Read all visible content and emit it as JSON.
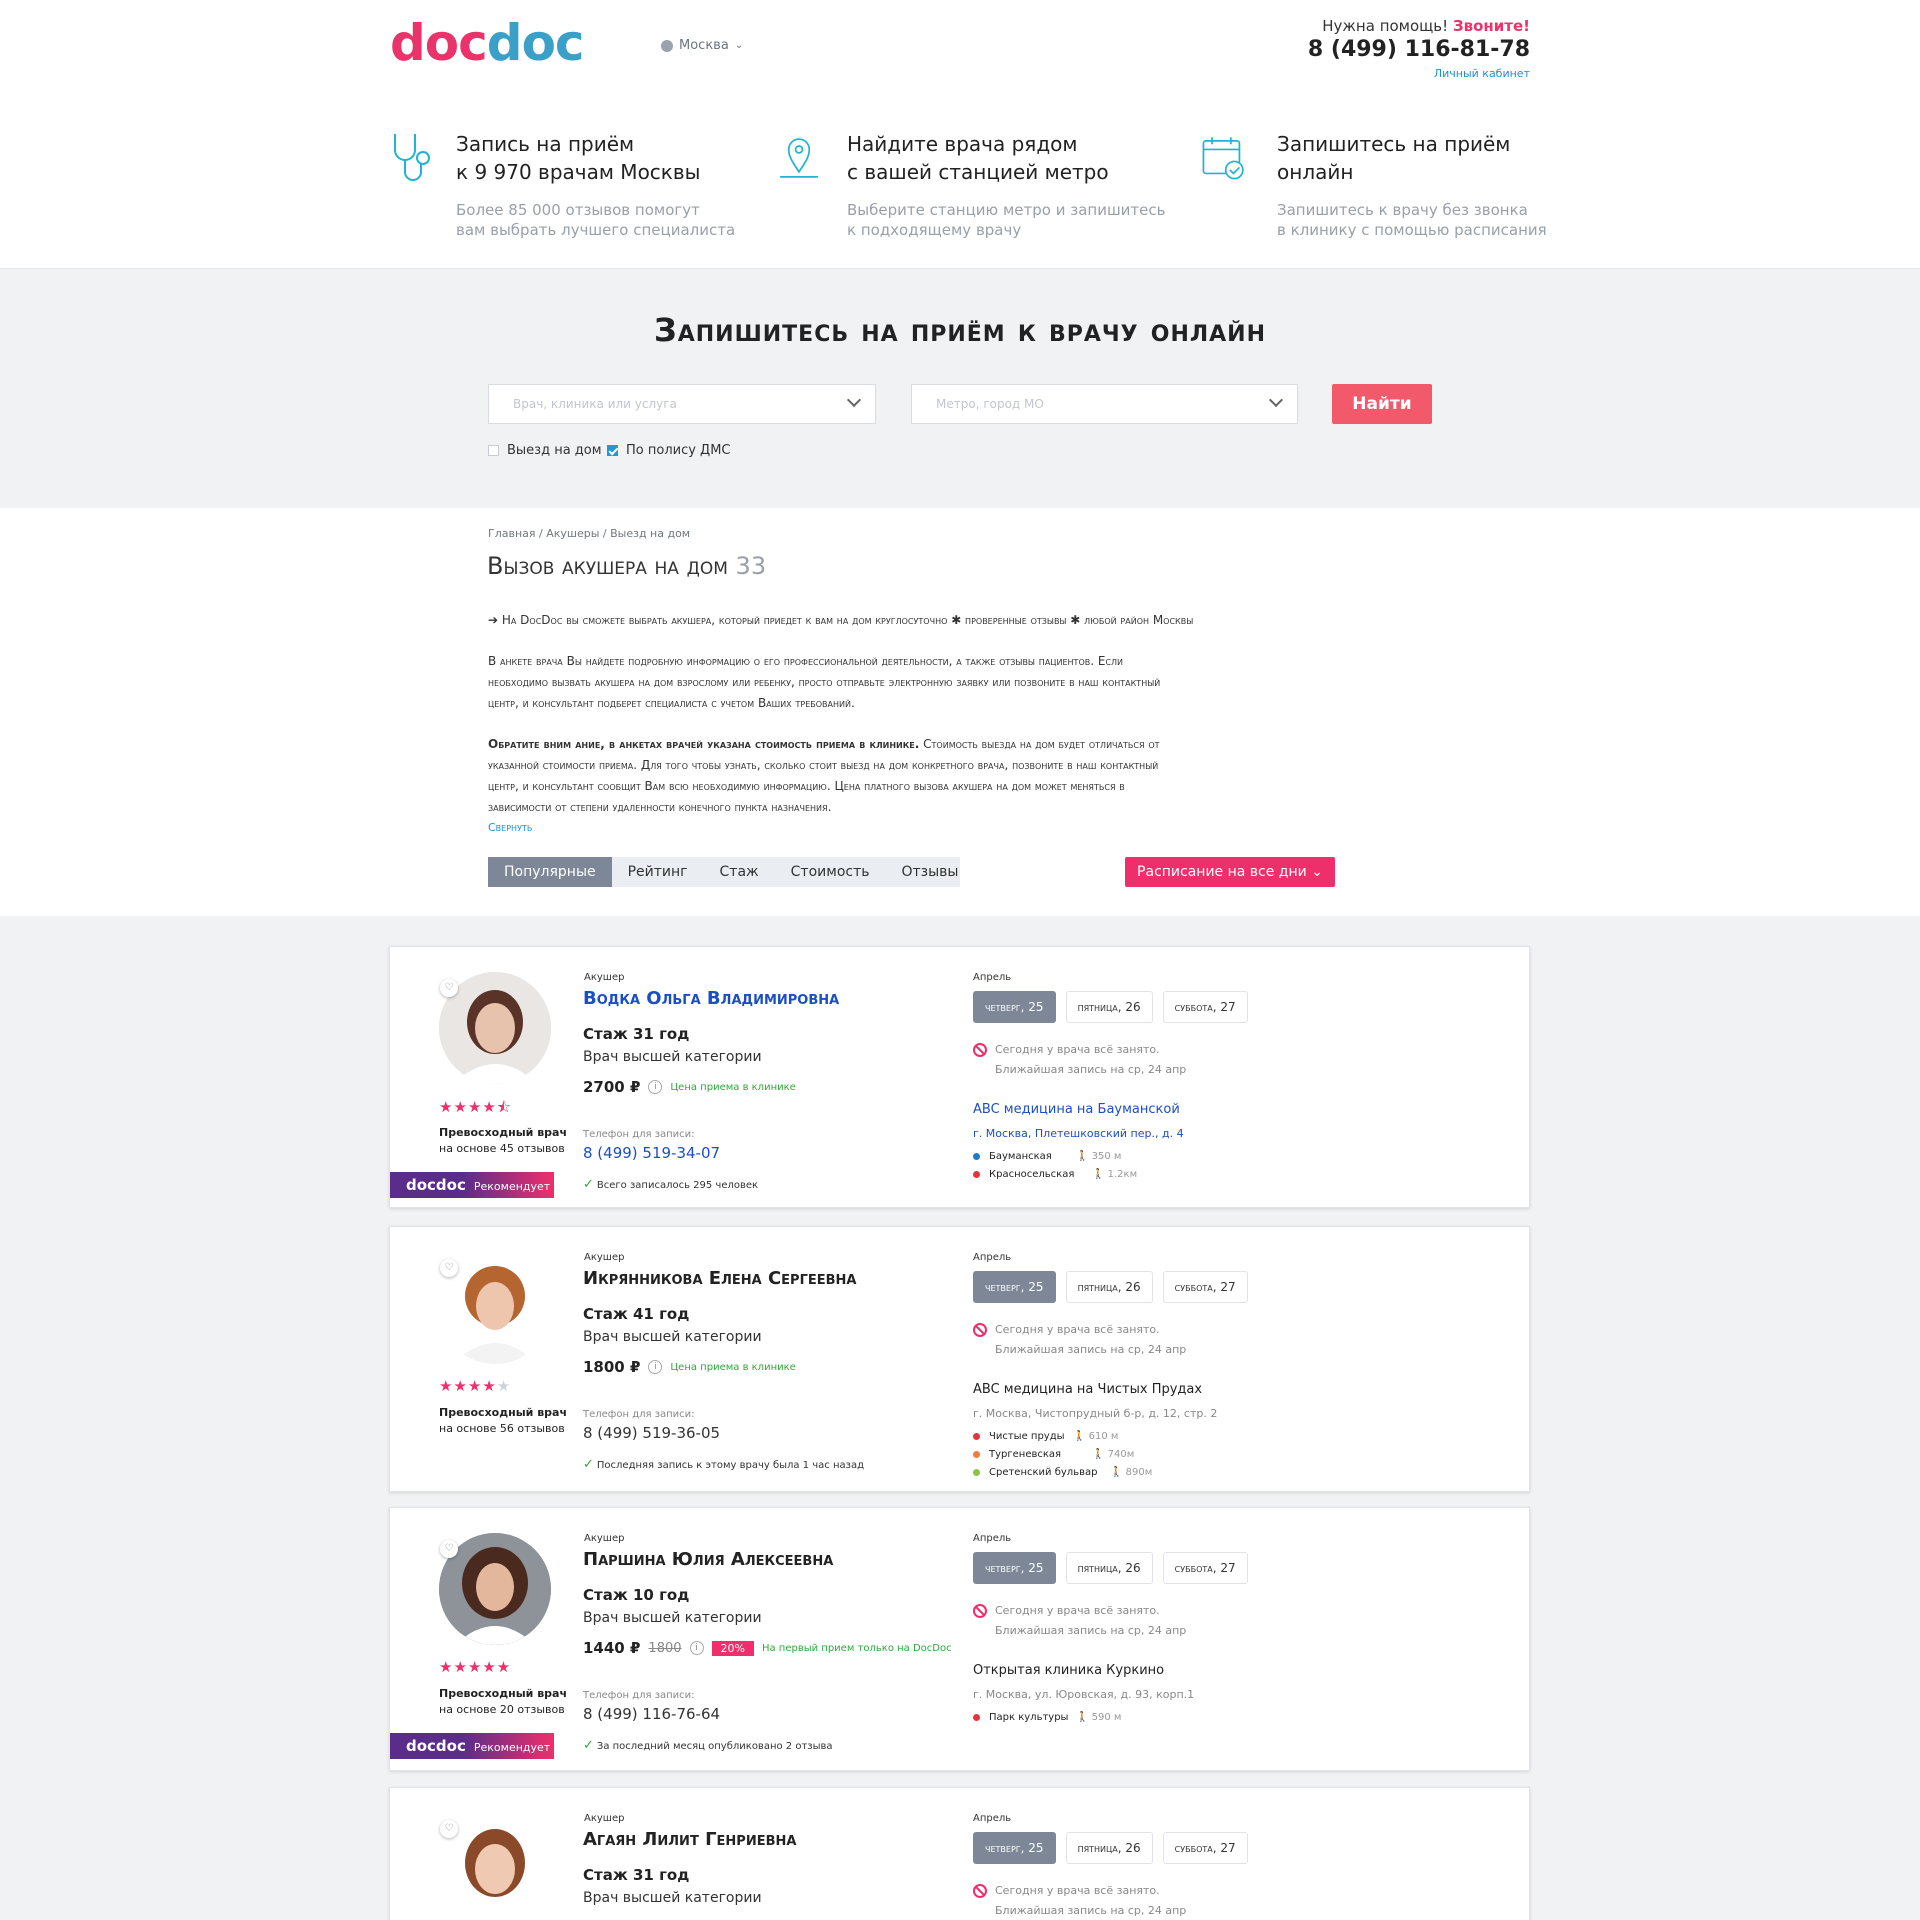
{
  "header": {
    "logo": [
      "doc",
      "doc"
    ],
    "city": "Москва",
    "help_text": "Нужна помощь!",
    "help_call": "Звоните!",
    "phone": "8 (499) 116-81-78",
    "cabinet": "Личный кабинет"
  },
  "features": [
    {
      "title1": "Запись на приём",
      "title2": "к 9 970 врачам Москвы",
      "desc1": "Более 85 000 отзывов помогут",
      "desc2": "вам выбрать лучшего специалиста",
      "icon": "stethoscope-icon"
    },
    {
      "title1": "Найдите врача рядом",
      "title2": "с вашей станцией метро",
      "desc1": "Выберите станцию метро и запишитесь",
      "desc2": "к подходящему врачу",
      "icon": "map-pin-icon"
    },
    {
      "title1": "Запишитесь на приём",
      "title2": "онлайн",
      "desc1": "Запишитесь к врачу без звонка",
      "desc2": "в клинику с помощью расписания",
      "icon": "calendar-check-icon"
    }
  ],
  "search": {
    "title": "Запишитесь на приём к врачу онлайн",
    "doctor_placeholder": "Врач, клиника или услуга",
    "metro_placeholder": "Метро, город МО",
    "find": "Найти",
    "home_visit": "Выезд на дом",
    "dms": "По полису ДМС"
  },
  "content": {
    "breadcrumbs": "Главная / Акушеры / Выезд на дом",
    "h1": "Вызов акушера на дом",
    "count": "33",
    "intro": "➔ На DocDoc вы сможете выбрать акушера, который приедет к вам на дом круглосуточно ✱ проверенные отзывы ✱ любой район Москвы",
    "para1a": "В анкете врача Вы найдете подробную информацию о его профессиональной деятельности, а также отзывы пациентов. Если",
    "para1b": "необходимо вызвать акушера на дом взрослому или ребенку, просто отправьте электронную заявку или позвоните в наш контактный",
    "para1c": "центр, и консультант подберет специалиста с учетом Ваших требований.",
    "para2_bold": "Обратите вним ание, в анкетах врачей указана стоимость приема в клинике.",
    "para2a": " Стоимость выезда на дом будет отличаться от",
    "para2b": "указанной стоимости приема. Для того чтобы узнать, сколько стоит выезд на дом конкретного врача, позвоните в наш контактный",
    "para2c": "центр, и консультант сообщит Вам всю необходимую информацию. Цена платного вызова акушера на дом может меняться в",
    "para2d": "зависимости от степени удаленности конечного пункта назначения.",
    "collapse": "Свернуть",
    "sort": [
      "Популярные",
      "Рейтинг",
      "Стаж",
      "Стоимость",
      "Отзывы"
    ],
    "schedule_btn": "Расписание на все дни"
  },
  "doctors": [
    {
      "spec": "Акушер",
      "name": "Водка Ольга Владимировна",
      "exp": "Стаж 31 год",
      "category": "Врач высшей категории",
      "price": "2700 ₽",
      "price_old": "",
      "discount": "",
      "price_note": "Цена приема в клинике",
      "tel_label": "Телефон для записи:",
      "tel": "8 (499) 519-34-07",
      "badge": "Всего записалось 295 человек",
      "rating": 4.5,
      "rating_text": "Превосходный врач",
      "reviews": "на основе 45 отзывов",
      "recommend": true,
      "recommend_logo": "docdoc",
      "recommend_text": "Рекомендует",
      "month": "Апрель",
      "days": [
        "четверг, 25",
        "пятница, 26",
        "суббота, 27"
      ],
      "busy1": "Сегодня у врача всё занято.",
      "busy2": "Ближайшая запись на ср, 24 апр",
      "clinic": "ABC медицина на Бауманской",
      "address": "г. Москва, Плетешковский пер., д. 4",
      "metro": [
        {
          "name": "Бауманская",
          "dist": "350 м",
          "color": "#1e7bc8"
        },
        {
          "name": "Красносельская",
          "dist": "1.2км",
          "color": "#e8333b"
        }
      ]
    },
    {
      "spec": "Акушер",
      "name": "Икрянникова Елена Сергеевна",
      "exp": "Стаж 41 год",
      "category": "Врач высшей категории",
      "price": "1800 ₽",
      "price_old": "",
      "discount": "",
      "price_note": "Цена приема в клинике",
      "tel_label": "Телефон для записи:",
      "tel": "8 (499) 519-36-05",
      "badge": "Последняя запись к этому врачу была 1 час назад",
      "rating": 4,
      "rating_text": "Превосходный врач",
      "reviews": "на основе 56 отзывов",
      "recommend": false,
      "month": "Апрель",
      "days": [
        "четверг, 25",
        "пятница, 26",
        "суббота, 27"
      ],
      "busy1": "Сегодня у врача всё занято.",
      "busy2": "Ближайшая запись на ср, 24 апр",
      "clinic": "ABC медицина на Чистых Прудах",
      "address": "г. Москва, Чистопрудный б-р, д. 12, стр. 2",
      "metro": [
        {
          "name": "Чистые пруды",
          "dist": "610 м",
          "color": "#e8333b"
        },
        {
          "name": "Тургеневская",
          "dist": "740м",
          "color": "#f07d3c"
        },
        {
          "name": "Сретенский бульвар",
          "dist": "890м",
          "color": "#8bc53f"
        }
      ]
    },
    {
      "spec": "Акушер",
      "name": "Паршина Юлия Алексеевна",
      "exp": "Стаж 10 год",
      "category": "Врач высшей категории",
      "price": "1440 ₽",
      "price_old": "1800",
      "discount": "20%",
      "price_note": "На первый прием только на DocDoc",
      "tel_label": "Телефон для записи:",
      "tel": "8 (499) 116-76-64",
      "badge": "За последний месяц опубликовано 2 отзыва",
      "rating": 5,
      "rating_text": "Превосходный врач",
      "reviews": "на основе 20 отзывов",
      "recommend": true,
      "recommend_logo": "docdoc",
      "recommend_text": "Рекомендует",
      "month": "Апрель",
      "days": [
        "четверг, 25",
        "пятница, 26",
        "суббота, 27"
      ],
      "busy1": "Сегодня у врача всё занято.",
      "busy2": "Ближайшая запись на ср, 24 апр",
      "clinic": "Открытая клиника Куркино",
      "address": "г. Москва, ул. Юровская, д. 93, корп.1",
      "metro": [
        {
          "name": "Парк культуры",
          "dist": "590 м",
          "color": "#e8333b"
        }
      ]
    },
    {
      "spec": "Акушер",
      "name": "Агаян Лилит Генриевна",
      "exp": "Стаж 31 год",
      "category": "Врач высшей категории",
      "month": "Апрель",
      "days": [
        "четверг, 25",
        "пятница, 26",
        "суббота, 27"
      ],
      "busy1": "Сегодня у врача всё занято.",
      "busy2": "Ближайшая запись на ср, 24 апр"
    }
  ],
  "colors": {
    "brand_pink": "#ef2f6c",
    "brand_blue": "#3aa0c8",
    "brand_purple": "#6a3d9a",
    "search_button": "#f2596b",
    "link": "#1a4fc4"
  }
}
